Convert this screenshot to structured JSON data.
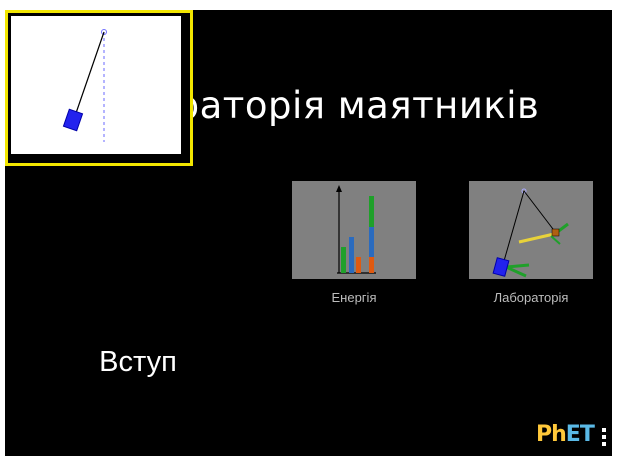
{
  "title": "Лабораторія маятників",
  "screens": [
    {
      "id": "intro",
      "label": "Вступ",
      "selected": true
    },
    {
      "id": "energy",
      "label": "Енергія",
      "selected": false
    },
    {
      "id": "lab",
      "label": "Лабораторія",
      "selected": false
    }
  ],
  "brand": {
    "logo_text": "PhET"
  },
  "colors": {
    "background": "#000000",
    "selection": "#f2e600",
    "thumbnail": "#808080"
  },
  "icons": [
    "pendulum-icon",
    "energy-chart-icon",
    "lab-pendulum-icon",
    "kebab-menu-icon"
  ]
}
